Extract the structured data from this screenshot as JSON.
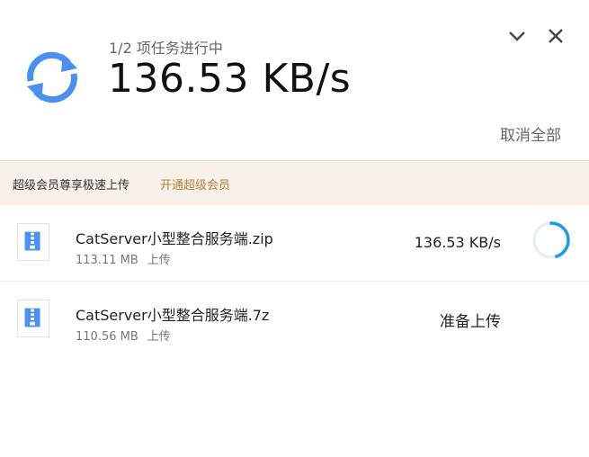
{
  "header": {
    "task_count": "1/2 项任务进行中",
    "speed": "136.53 KB/s",
    "cancel_all": "取消全部",
    "icons": {
      "status": "sync-icon",
      "collapse": "chevron-down-icon",
      "close": "close-icon"
    },
    "accent_color": "#4a90f0"
  },
  "promo": {
    "text": "超级会员尊享极速上传",
    "link": "开通超级会员",
    "link_color": "#b88135"
  },
  "tasks": [
    {
      "name": "CatServer小型整合服务端.zip",
      "size": "113.11 MB",
      "type": "上传",
      "speed": "136.53 KB/s",
      "icon": "zip-file-icon",
      "progress": 0.45
    },
    {
      "name": "CatServer小型整合服务端.7z",
      "size": "110.56 MB",
      "type": "上传",
      "status": "准备上传",
      "icon": "zip-file-icon"
    }
  ]
}
